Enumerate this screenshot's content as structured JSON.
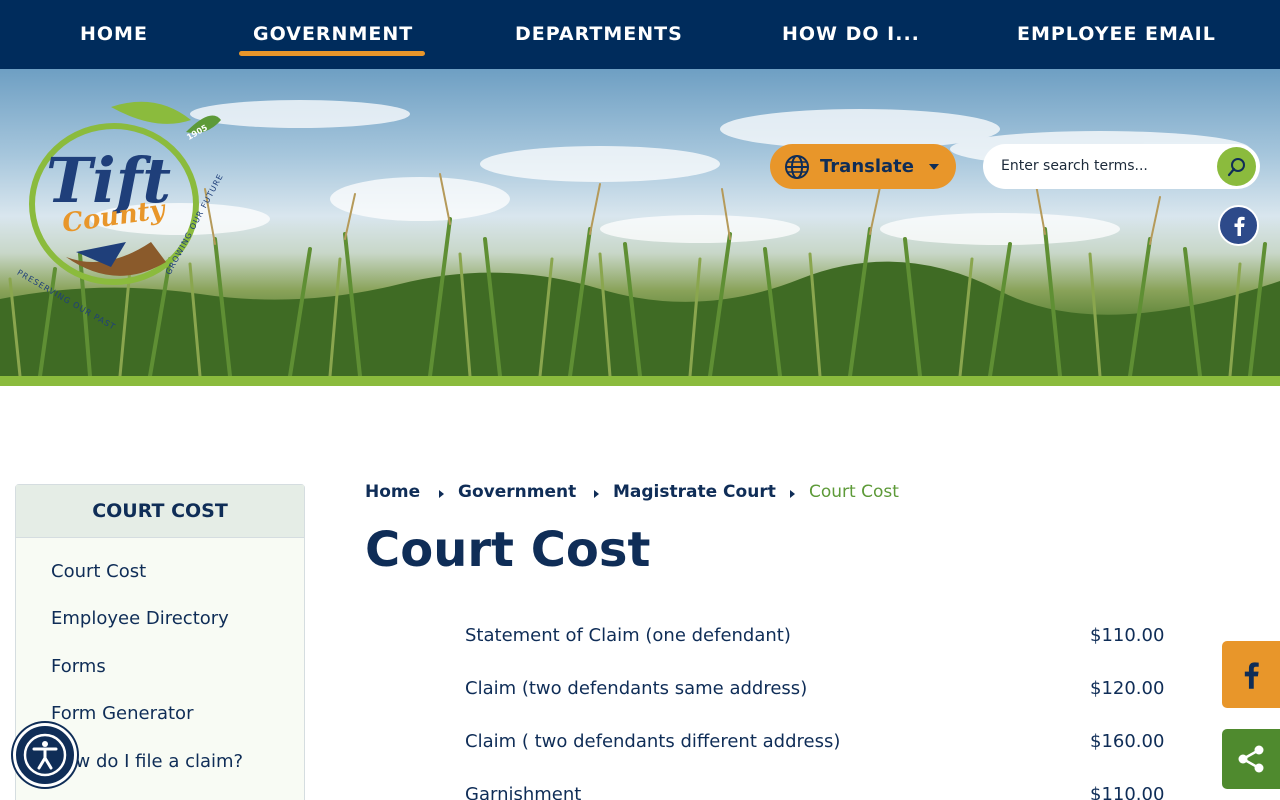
{
  "nav": {
    "items": [
      {
        "label": "HOME"
      },
      {
        "label": "GOVERNMENT"
      },
      {
        "label": "DEPARTMENTS"
      },
      {
        "label": "HOW DO I..."
      },
      {
        "label": "EMPLOYEE EMAIL"
      }
    ],
    "active": "GOVERNMENT"
  },
  "logo": {
    "main_text": "Tift",
    "sub_text": "County",
    "year": "1905",
    "ring_left": "PRESERVING OUR PAST",
    "ring_right": "GROWING OUR FUTURE",
    "colors": {
      "navy": "#1f3f7a",
      "green": "#8bbb3d",
      "orange": "#e8962a"
    }
  },
  "header": {
    "translate_label": "Translate",
    "translate_icon": "globe-icon",
    "search_placeholder": "Enter search terms...",
    "search_icon": "search-icon",
    "social_icon": "facebook-icon"
  },
  "sidebar": {
    "title": "COURT COST",
    "items": [
      {
        "label": "Court Cost"
      },
      {
        "label": "Employee Directory"
      },
      {
        "label": "Forms"
      },
      {
        "label": "Form Generator"
      },
      {
        "label": "How do I file a claim?"
      }
    ]
  },
  "breadcrumb": [
    {
      "label": "Home"
    },
    {
      "label": "Government"
    },
    {
      "label": "Magistrate Court"
    },
    {
      "label": "Court Cost"
    }
  ],
  "main": {
    "title": "Court Cost",
    "costs": [
      {
        "description": "Statement of Claim (one defendant)",
        "amount": "$110.00"
      },
      {
        "description": "Claim (two defendants same address)",
        "amount": "$120.00"
      },
      {
        "description": "Claim ( two defendants different address)",
        "amount": "$160.00"
      },
      {
        "description": "Garnishment",
        "amount": "$110.00"
      }
    ]
  },
  "floating": {
    "facebook_icon": "facebook-icon",
    "share_icon": "share-icon",
    "accessibility_icon": "accessibility-icon"
  },
  "colors": {
    "navy": "#002c5c",
    "text": "#0f2d57",
    "orange": "#e8962a",
    "green": "#8bbb3d",
    "breadcrumb_current": "#5d9a38"
  }
}
